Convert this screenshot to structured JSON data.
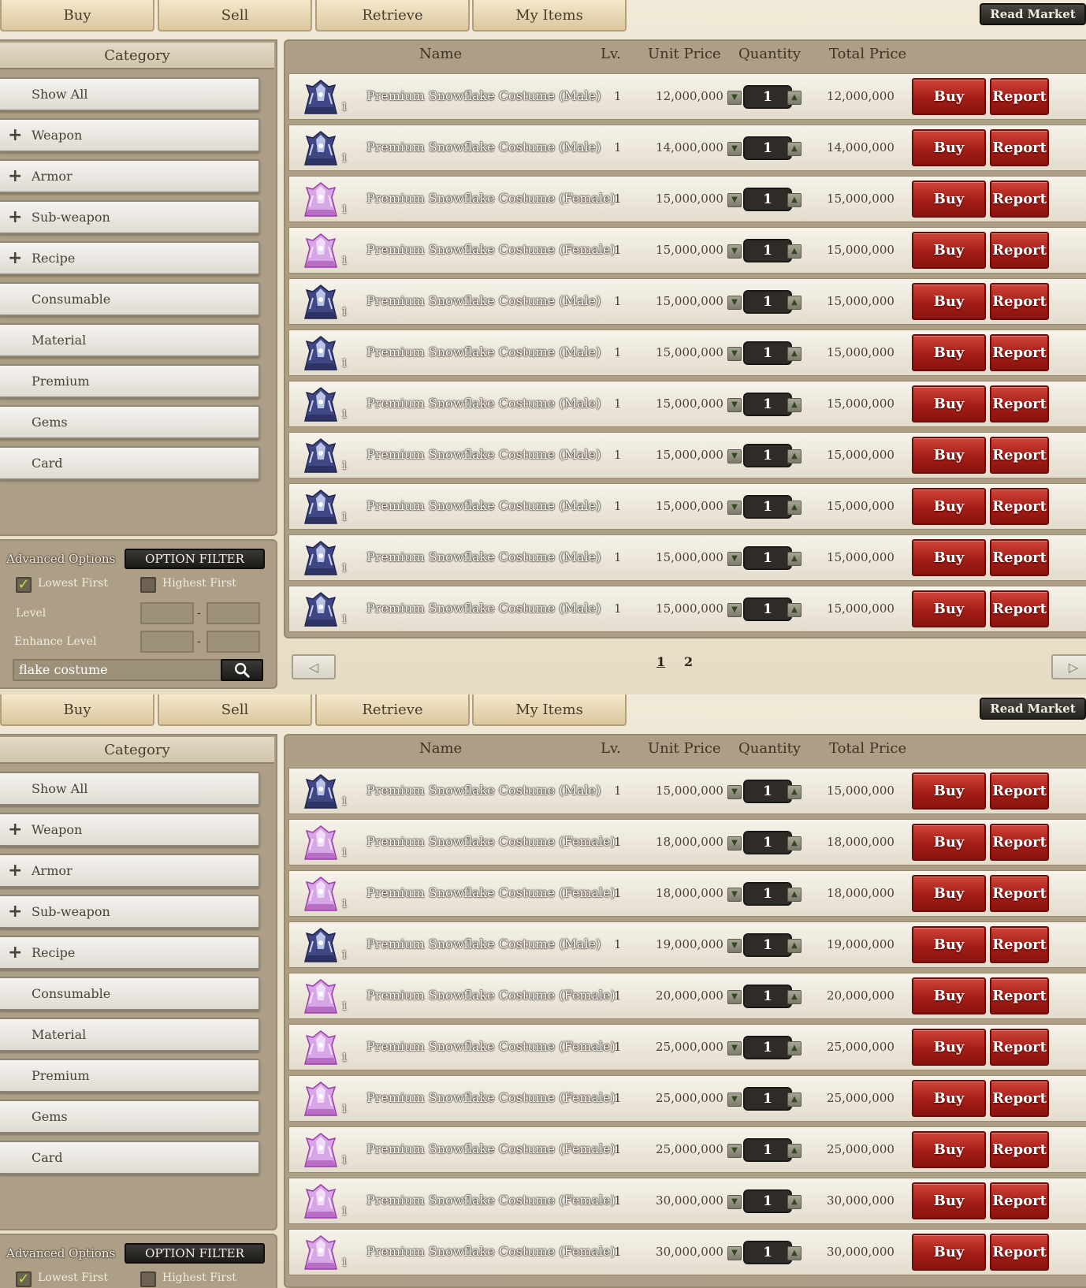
{
  "tabs": [
    "Buy",
    "Sell",
    "Retrieve",
    "My Items"
  ],
  "read_market": "Read Market",
  "sidebar": {
    "header": "Category",
    "items": [
      {
        "label": "Show All",
        "expandable": false
      },
      {
        "label": "Weapon",
        "expandable": true
      },
      {
        "label": "Armor",
        "expandable": true
      },
      {
        "label": "Sub-weapon",
        "expandable": true
      },
      {
        "label": "Recipe",
        "expandable": true
      },
      {
        "label": "Consumable",
        "expandable": false
      },
      {
        "label": "Material",
        "expandable": false
      },
      {
        "label": "Premium",
        "expandable": false
      },
      {
        "label": "Gems",
        "expandable": false
      },
      {
        "label": "Card",
        "expandable": false
      }
    ]
  },
  "advanced": {
    "label": "Advanced Options",
    "filter_button": "OPTION FILTER",
    "lowest_first": "Lowest First",
    "highest_first": "Highest First",
    "lowest_checked": true,
    "highest_checked": false,
    "level_label": "Level",
    "enhance_label": "Enhance Level",
    "range_dash": "-",
    "search_value": "flake costume"
  },
  "columns": {
    "name": "Name",
    "lv": "Lv.",
    "unit_price": "Unit Price",
    "quantity": "Quantity",
    "total_price": "Total Price"
  },
  "buttons": {
    "buy": "Buy",
    "report": "Report"
  },
  "icon_count": "1",
  "pagination": {
    "pages": [
      "1",
      "2"
    ],
    "current": "1"
  },
  "panels": [
    {
      "rows": [
        {
          "name": "Premium Snowflake Costume (Male)",
          "gender": "male",
          "lv": "1",
          "unit": "12,000,000",
          "qty": "1",
          "total": "12,000,000"
        },
        {
          "name": "Premium Snowflake Costume (Male)",
          "gender": "male",
          "lv": "1",
          "unit": "14,000,000",
          "qty": "1",
          "total": "14,000,000"
        },
        {
          "name": "Premium Snowflake Costume (Female)",
          "gender": "female",
          "lv": "1",
          "unit": "15,000,000",
          "qty": "1",
          "total": "15,000,000"
        },
        {
          "name": "Premium Snowflake Costume (Female)",
          "gender": "female",
          "lv": "1",
          "unit": "15,000,000",
          "qty": "1",
          "total": "15,000,000"
        },
        {
          "name": "Premium Snowflake Costume (Male)",
          "gender": "male",
          "lv": "1",
          "unit": "15,000,000",
          "qty": "1",
          "total": "15,000,000"
        },
        {
          "name": "Premium Snowflake Costume (Male)",
          "gender": "male",
          "lv": "1",
          "unit": "15,000,000",
          "qty": "1",
          "total": "15,000,000"
        },
        {
          "name": "Premium Snowflake Costume (Male)",
          "gender": "male",
          "lv": "1",
          "unit": "15,000,000",
          "qty": "1",
          "total": "15,000,000"
        },
        {
          "name": "Premium Snowflake Costume (Male)",
          "gender": "male",
          "lv": "1",
          "unit": "15,000,000",
          "qty": "1",
          "total": "15,000,000"
        },
        {
          "name": "Premium Snowflake Costume (Male)",
          "gender": "male",
          "lv": "1",
          "unit": "15,000,000",
          "qty": "1",
          "total": "15,000,000"
        },
        {
          "name": "Premium Snowflake Costume (Male)",
          "gender": "male",
          "lv": "1",
          "unit": "15,000,000",
          "qty": "1",
          "total": "15,000,000"
        },
        {
          "name": "Premium Snowflake Costume (Male)",
          "gender": "male",
          "lv": "1",
          "unit": "15,000,000",
          "qty": "1",
          "total": "15,000,000"
        }
      ]
    },
    {
      "rows": [
        {
          "name": "Premium Snowflake Costume (Male)",
          "gender": "male",
          "lv": "1",
          "unit": "15,000,000",
          "qty": "1",
          "total": "15,000,000"
        },
        {
          "name": "Premium Snowflake Costume (Female)",
          "gender": "female",
          "lv": "1",
          "unit": "18,000,000",
          "qty": "1",
          "total": "18,000,000"
        },
        {
          "name": "Premium Snowflake Costume (Female)",
          "gender": "female",
          "lv": "1",
          "unit": "18,000,000",
          "qty": "1",
          "total": "18,000,000"
        },
        {
          "name": "Premium Snowflake Costume (Male)",
          "gender": "male",
          "lv": "1",
          "unit": "19,000,000",
          "qty": "1",
          "total": "19,000,000"
        },
        {
          "name": "Premium Snowflake Costume (Female)",
          "gender": "female",
          "lv": "1",
          "unit": "20,000,000",
          "qty": "1",
          "total": "20,000,000"
        },
        {
          "name": "Premium Snowflake Costume (Female)",
          "gender": "female",
          "lv": "1",
          "unit": "25,000,000",
          "qty": "1",
          "total": "25,000,000"
        },
        {
          "name": "Premium Snowflake Costume (Female)",
          "gender": "female",
          "lv": "1",
          "unit": "25,000,000",
          "qty": "1",
          "total": "25,000,000"
        },
        {
          "name": "Premium Snowflake Costume (Female)",
          "gender": "female",
          "lv": "1",
          "unit": "25,000,000",
          "qty": "1",
          "total": "25,000,000"
        },
        {
          "name": "Premium Snowflake Costume (Female)",
          "gender": "female",
          "lv": "1",
          "unit": "30,000,000",
          "qty": "1",
          "total": "30,000,000"
        },
        {
          "name": "Premium Snowflake Costume (Female)",
          "gender": "female",
          "lv": "1",
          "unit": "30,000,000",
          "qty": "1",
          "total": "30,000,000"
        }
      ]
    }
  ]
}
